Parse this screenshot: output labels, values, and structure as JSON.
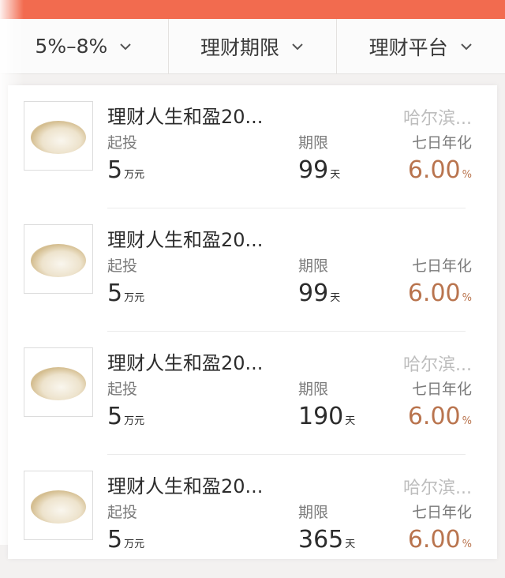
{
  "header": {
    "title": ""
  },
  "filters": [
    {
      "label": "5%–8%",
      "icon": "chevron-down-icon"
    },
    {
      "label": "理财期限",
      "icon": "chevron-down-icon"
    },
    {
      "label": "理财平台",
      "icon": "chevron-down-icon"
    }
  ],
  "labels": {
    "min": "起投",
    "term": "期限",
    "rate": "七日年化"
  },
  "products": [
    {
      "name": "理财人生和盈20...",
      "platform": "哈尔滨...",
      "min_value": "5",
      "min_unit": "万元",
      "term_value": "99",
      "term_unit": "天",
      "rate_value": "6.00",
      "rate_unit": "%"
    },
    {
      "name": "理财人生和盈20...",
      "platform": "",
      "min_value": "5",
      "min_unit": "万元",
      "term_value": "99",
      "term_unit": "天",
      "rate_value": "6.00",
      "rate_unit": "%"
    },
    {
      "name": "理财人生和盈20...",
      "platform": "哈尔滨...",
      "min_value": "5",
      "min_unit": "万元",
      "term_value": "190",
      "term_unit": "天",
      "rate_value": "6.00",
      "rate_unit": "%"
    },
    {
      "name": "理财人生和盈20...",
      "platform": "哈尔滨...",
      "min_value": "5",
      "min_unit": "万元",
      "term_value": "365",
      "term_unit": "天",
      "rate_value": "6.00",
      "rate_unit": "%"
    }
  ],
  "colors": {
    "topbar": "#f26b4f",
    "rate": "#b9744e"
  }
}
